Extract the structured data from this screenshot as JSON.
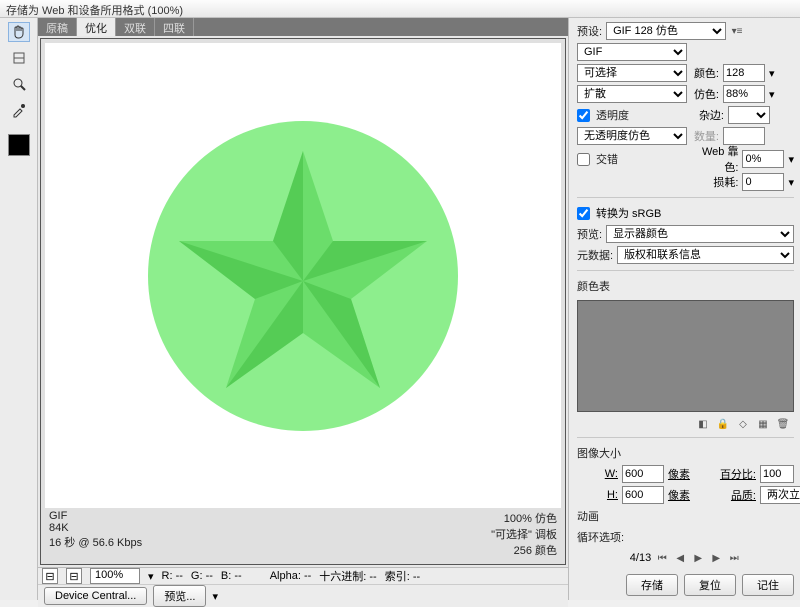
{
  "window": {
    "title": "存储为 Web 和设备所用格式 (100%)"
  },
  "tabs": {
    "items": [
      "原稿",
      "优化",
      "双联",
      "四联"
    ],
    "active": 1
  },
  "canvas": {
    "format": "GIF",
    "filesize": "84K",
    "transfer": "16 秒 @ 56.6 Kbps",
    "zoom_pct": "100%",
    "dither_label": "仿色",
    "algo_label": "\"可选择\"  调板",
    "colors_label": "256 颜色"
  },
  "bottombar": {
    "zoom": "100%",
    "r": "R:  --",
    "g": "G:  --",
    "b": "B:  --",
    "alpha": "Alpha: --",
    "hex": "十六进制: --",
    "index": "索引: --"
  },
  "devicebar": {
    "btn": "Device Central...",
    "preview": "预览..."
  },
  "panel": {
    "preset_lbl": "预设:",
    "preset": "GIF 128 仿色",
    "format": "GIF",
    "algo_lbl": "",
    "algo": "可选择",
    "colors_lbl": "颜色:",
    "colors": "128",
    "dither_lbl": "",
    "dither": "扩散",
    "dither_pct_lbl": "仿色:",
    "dither_pct": "88%",
    "transparency_chk": "透明度",
    "matte_lbl": "杂边:",
    "trans_dither": "无透明度仿色",
    "amount_lbl": "数量:",
    "interlace_chk": "交错",
    "websnap_lbl": "Web 靠色:",
    "websnap": "0%",
    "lossy_lbl": "损耗:",
    "lossy": "0",
    "convert_srgb": "转换为 sRGB",
    "preview_lbl": "预览:",
    "preview": "显示器颜色",
    "meta_lbl": "元数据:",
    "meta": "版权和联系信息",
    "colortable_lbl": "颜色表",
    "imagesize_lbl": "图像大小",
    "w_lbl": "W:",
    "w": "600",
    "w_unit": "像素",
    "h_lbl": "H:",
    "h": "600",
    "h_unit": "像素",
    "percent_lbl": "百分比:",
    "percent": "100",
    "quality_lbl": "品质:",
    "quality": "两次立方",
    "anim_lbl": "动画",
    "loop_lbl": "循环选项:",
    "frame": "4/13"
  },
  "actions": {
    "save": "存储",
    "reset": "复位",
    "remember": "记住"
  }
}
